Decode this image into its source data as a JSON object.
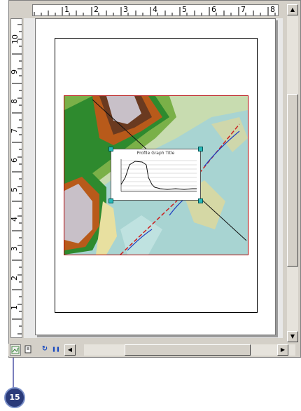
{
  "ruler_top": {
    "labels": [
      "1",
      "2",
      "3",
      "4",
      "5",
      "6",
      "7",
      "8"
    ]
  },
  "ruler_left": {
    "labels": [
      "10",
      "9",
      "8",
      "7",
      "6",
      "5",
      "4",
      "3",
      "2",
      "1"
    ]
  },
  "profile_graph": {
    "title": "Profile Graph Title"
  },
  "scrollbar": {
    "up_arrow": "▲",
    "down_arrow": "▼",
    "left_arrow": "◀",
    "right_arrow": "▶"
  },
  "toolbar": {
    "refresh_glyph": "↻",
    "pause_glyph": "❚❚"
  },
  "callout": {
    "number": "15"
  },
  "colors": {
    "map_border": "#b00000",
    "selection_handle": "#28b8b8",
    "callout_fill": "#2a3a7a"
  },
  "icons": [
    "data-view-icon",
    "layout-view-icon",
    "refresh-icon",
    "pause-drawing-icon"
  ]
}
